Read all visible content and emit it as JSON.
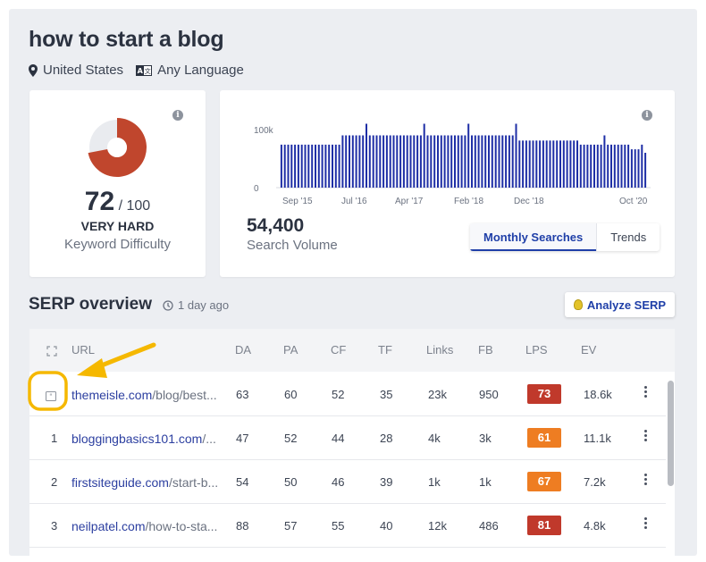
{
  "header": {
    "title": "how to start a blog",
    "location": "United States",
    "language": "Any Language"
  },
  "difficulty": {
    "score": "72",
    "max": "/ 100",
    "score_fraction": 0.72,
    "level": "VERY HARD",
    "label": "Keyword Difficulty",
    "color": "#c0462d"
  },
  "volume": {
    "value": "54,400",
    "label": "Search Volume",
    "tabs": [
      "Monthly Searches",
      "Trends"
    ],
    "active_tab": "Monthly Searches",
    "chart_data": {
      "type": "bar",
      "color": "#1f2fa6",
      "y_tick_labels": [
        "100k",
        "0"
      ],
      "ylim": [
        0,
        100000
      ],
      "x_tick_labels": [
        "Sep '15",
        "Jul '16",
        "Apr '17",
        "Feb '18",
        "Dec '18",
        "Oct '20"
      ],
      "values": [
        74000,
        74000,
        74000,
        74000,
        74000,
        74000,
        74000,
        74000,
        74000,
        74000,
        74000,
        74000,
        74000,
        74000,
        74000,
        74000,
        74000,
        74000,
        90000,
        90000,
        90000,
        90000,
        90000,
        90000,
        90000,
        110000,
        90000,
        90000,
        90000,
        90000,
        90000,
        90000,
        90000,
        90000,
        90000,
        90000,
        90000,
        90000,
        90000,
        90000,
        90000,
        90000,
        110000,
        90000,
        90000,
        90000,
        90000,
        90000,
        90000,
        90000,
        90000,
        90000,
        90000,
        90000,
        90000,
        110000,
        90000,
        90000,
        90000,
        90000,
        90000,
        90000,
        90000,
        90000,
        90000,
        90000,
        90000,
        90000,
        90000,
        110000,
        81000,
        81000,
        81000,
        81000,
        81000,
        81000,
        81000,
        81000,
        81000,
        81000,
        81000,
        81000,
        81000,
        81000,
        81000,
        81000,
        81000,
        81000,
        74000,
        74000,
        74000,
        74000,
        74000,
        74000,
        74000,
        90000,
        74000,
        74000,
        74000,
        74000,
        74000,
        74000,
        74000,
        66000,
        66000,
        66000,
        74000,
        60000
      ]
    }
  },
  "serp": {
    "title": "SERP overview",
    "updated": "1 day ago",
    "analyze_label": "Analyze SERP",
    "columns": [
      "URL",
      "DA",
      "PA",
      "CF",
      "TF",
      "Links",
      "FB",
      "LPS",
      "EV"
    ],
    "rows": [
      {
        "rank": "",
        "domain": "themeisle.com",
        "path": "/blog/best...",
        "da": "63",
        "pa": "60",
        "cf": "52",
        "tf": "35",
        "links": "23k",
        "fb": "950",
        "lps": "73",
        "lps_color": "#c0392b",
        "ev": "18.6k"
      },
      {
        "rank": "1",
        "domain": "bloggingbasics101.com",
        "path": "/...",
        "da": "47",
        "pa": "52",
        "cf": "44",
        "tf": "28",
        "links": "4k",
        "fb": "3k",
        "lps": "61",
        "lps_color": "#ee7d22",
        "ev": "11.1k"
      },
      {
        "rank": "2",
        "domain": "firstsiteguide.com",
        "path": "/start-b...",
        "da": "54",
        "pa": "50",
        "cf": "46",
        "tf": "39",
        "links": "1k",
        "fb": "1k",
        "lps": "67",
        "lps_color": "#ee7d22",
        "ev": "7.2k"
      },
      {
        "rank": "3",
        "domain": "neilpatel.com",
        "path": "/how-to-sta...",
        "da": "88",
        "pa": "57",
        "cf": "55",
        "tf": "40",
        "links": "12k",
        "fb": "486",
        "lps": "81",
        "lps_color": "#c0392b",
        "ev": "4.8k"
      }
    ]
  },
  "annotation": {
    "color": "#f5b800"
  }
}
